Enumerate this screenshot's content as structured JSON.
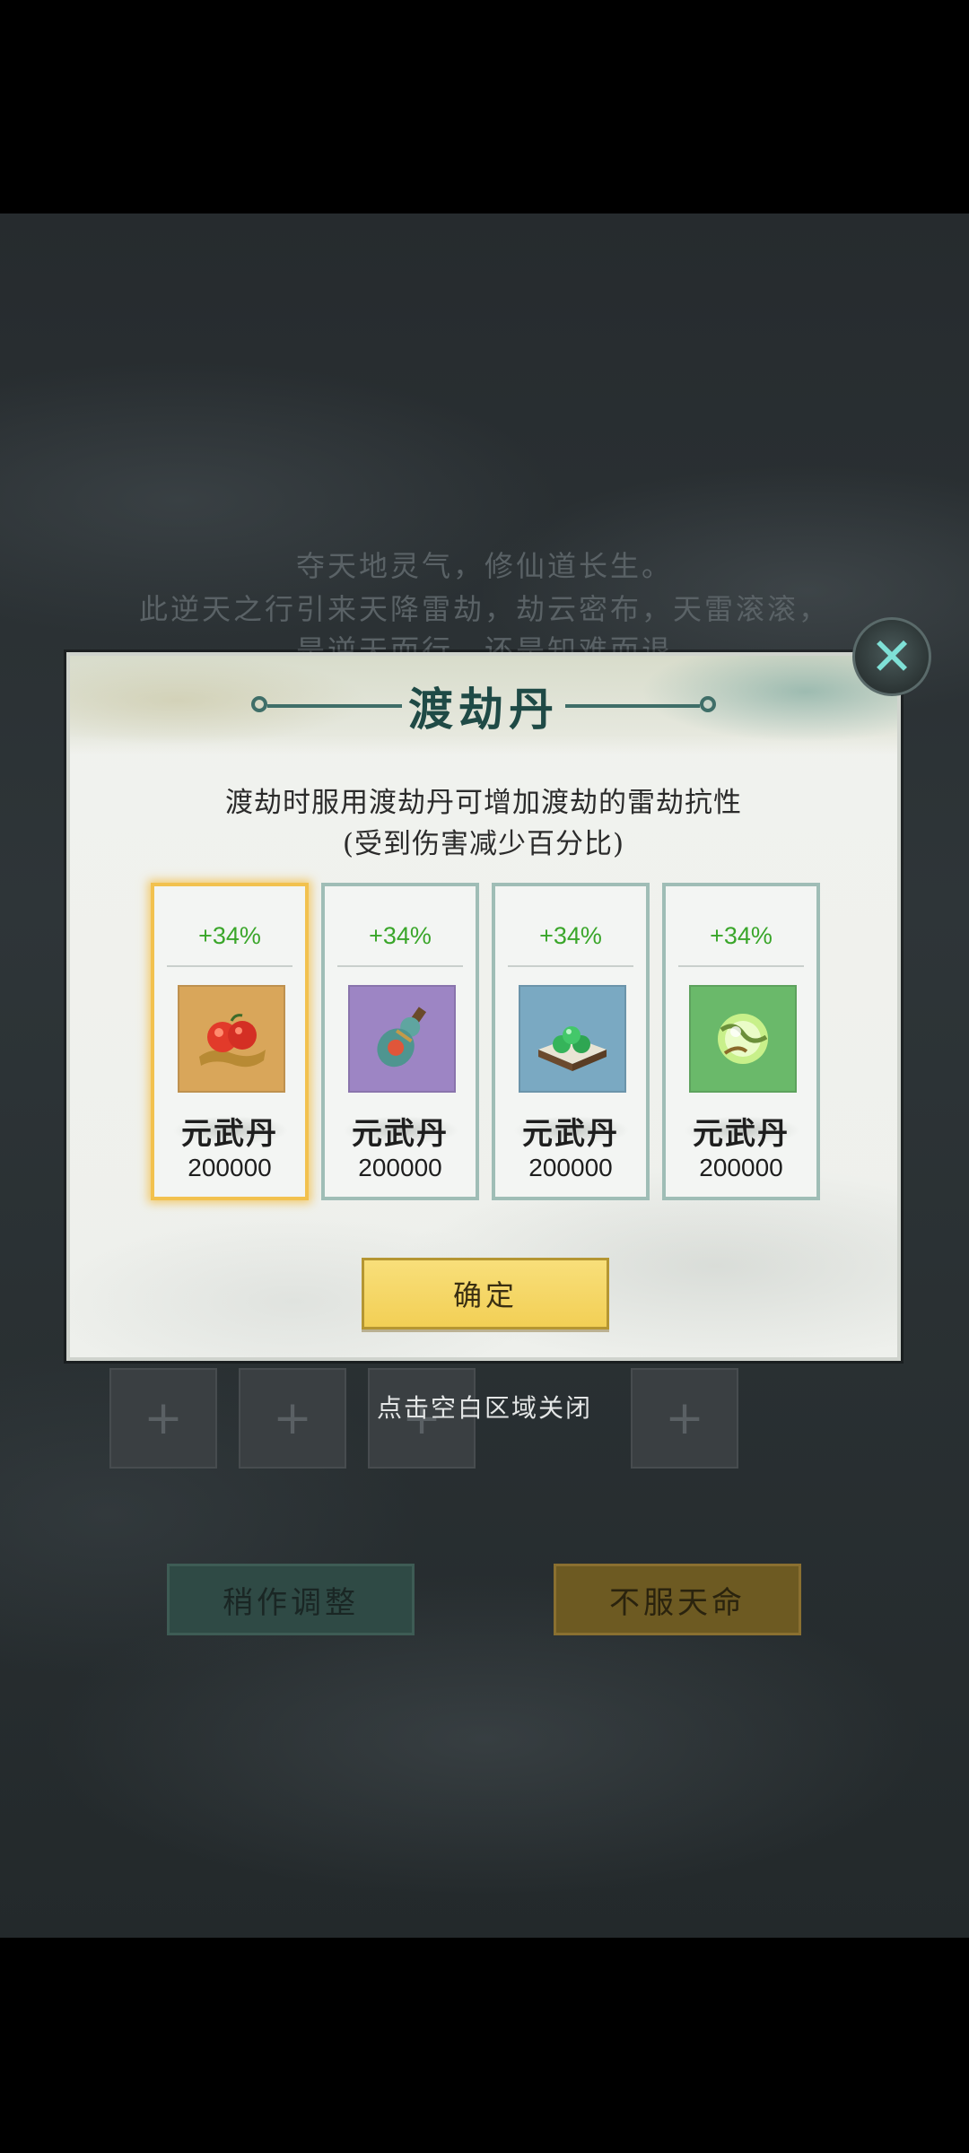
{
  "intro": {
    "line1": "夺天地灵气，修仙道长生。",
    "line2": "此逆天之行引来天降雷劫，劫云密布，天雷滚滚，",
    "line3": "是逆天而行，还是知难而退"
  },
  "dialog": {
    "title": "渡劫丹",
    "description_line1": "渡劫时服用渡劫丹可增加渡劫的雷劫抗性",
    "description_line2": "(受到伤害减少百分比)",
    "items": [
      {
        "bonus": "+34%",
        "name": "元武丹",
        "price": "200000",
        "icon": "red-fruit-icon",
        "bg": "#d9a65a",
        "selected": true
      },
      {
        "bonus": "+34%",
        "name": "元武丹",
        "price": "200000",
        "icon": "gourd-bottle-icon",
        "bg": "#9d85c4",
        "selected": false
      },
      {
        "bonus": "+34%",
        "name": "元武丹",
        "price": "200000",
        "icon": "green-pills-icon",
        "bg": "#7aa9c2",
        "selected": false
      },
      {
        "bonus": "+34%",
        "name": "元武丹",
        "price": "200000",
        "icon": "jade-orb-icon",
        "bg": "#6ab96a",
        "selected": false
      }
    ],
    "confirm_label": "确定"
  },
  "hint": "点击空白区域关闭",
  "buttons": {
    "adjust_label": "稍作调整",
    "defy_label": "不服天命"
  }
}
